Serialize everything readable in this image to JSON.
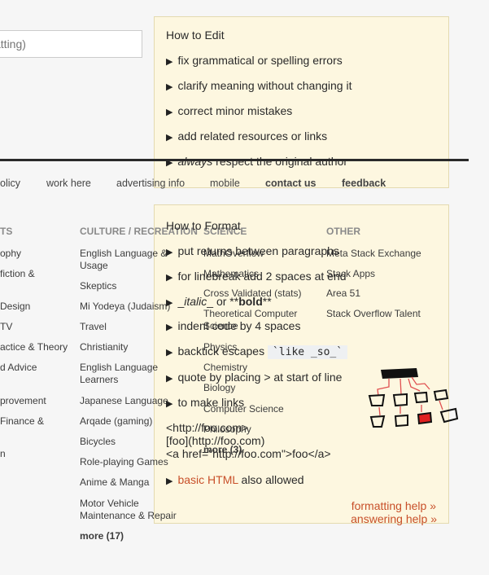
{
  "search": {
    "placeholder": "atting)"
  },
  "edit_help": {
    "title": "How to Edit",
    "items": [
      "fix grammatical or spelling errors",
      "clarify meaning without changing it",
      "correct minor mistakes",
      "add related resources or links"
    ],
    "last_em": "always",
    "last_rest": " respect the original author"
  },
  "footer": {
    "links": [
      "olicy",
      "work here",
      "advertising info",
      "mobile",
      "contact us",
      "feedback"
    ]
  },
  "format_help": {
    "title": "How to Format",
    "items": [
      "put returns between paragraphs",
      "for linebreak add 2 spaces at end"
    ],
    "italic_pre": "_",
    "italic": "italic",
    "italic_post": "_ or **",
    "bold": "bold",
    "bold_post": "**",
    "indent": "indent code by 4 spaces",
    "backtick": "backtick escapes ",
    "backtick_code": "`like _so_`",
    "quote": "quote by placing > at start of line",
    "links": "to make links",
    "link_examples": [
      "<http://foo.com>",
      "[foo](http://foo.com)",
      "<a href=\"http://foo.com\">foo</a>"
    ],
    "html_link": "basic HTML",
    "html_rest": " also allowed",
    "formatting_help": "formatting help »",
    "answering_help": "answering help »"
  },
  "columns": {
    "partial": {
      "header": "TS",
      "items": [
        "ophy",
        "fiction &",
        "Design",
        "TV",
        "actice & Theory",
        "d Advice",
        "provement",
        "Finance &",
        "n"
      ]
    },
    "culture": {
      "header": "CULTURE / RECREATION",
      "items": [
        "English Language &",
        "Usage",
        "Skeptics",
        "Mi Yodeya (Judaism)",
        "Travel",
        "Christianity",
        "English Language",
        "Learners",
        "Japanese Language",
        "Arqade (gaming)",
        "Bicycles",
        "Role-playing Games",
        "Anime & Manga",
        "Motor Vehicle",
        "Maintenance & Repair"
      ],
      "more": "more (17)"
    },
    "science": {
      "header": "SCIENCE",
      "items": [
        "MathOverflow",
        "Mathematics",
        "Cross Validated (stats)",
        "Theoretical Computer",
        "Science",
        "Physics",
        "Chemistry",
        "Biology",
        "Computer Science",
        "Philosophy"
      ],
      "more": "more (3)"
    },
    "other": {
      "header": "OTHER",
      "items": [
        "Meta Stack Exchange",
        "Stack Apps",
        "Area 51",
        "Stack Overflow Talent"
      ]
    }
  },
  "colors": {
    "accent": "#c8502a",
    "box_bg": "#fdf7e0"
  }
}
